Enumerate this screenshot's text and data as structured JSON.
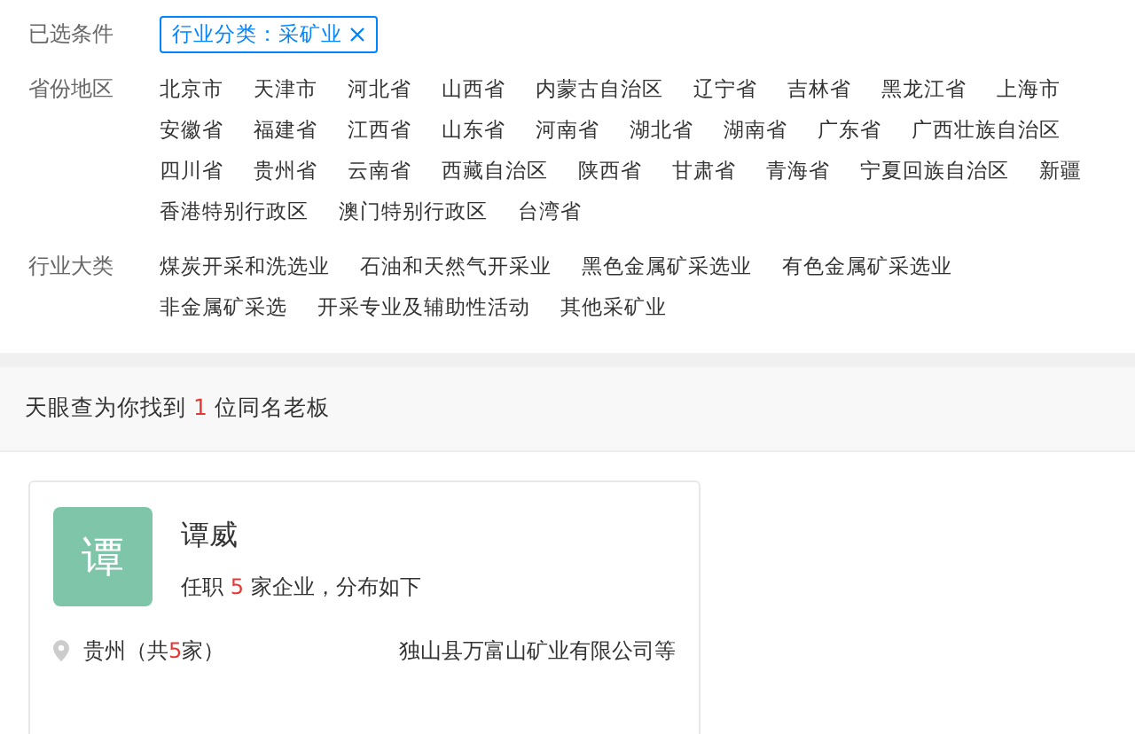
{
  "selected_conditions": {
    "label": "已选条件",
    "tags": [
      {
        "text": "行业分类：采矿业"
      }
    ]
  },
  "filters": [
    {
      "label": "省份地区",
      "options": [
        "北京市",
        "天津市",
        "河北省",
        "山西省",
        "内蒙古自治区",
        "辽宁省",
        "吉林省",
        "黑龙江省",
        "上海市",
        "安徽省",
        "福建省",
        "江西省",
        "山东省",
        "河南省",
        "湖北省",
        "湖南省",
        "广东省",
        "广西壮族自治区",
        "四川省",
        "贵州省",
        "云南省",
        "西藏自治区",
        "陕西省",
        "甘肃省",
        "青海省",
        "宁夏回族自治区",
        "新疆",
        "香港特别行政区",
        "澳门特别行政区",
        "台湾省"
      ]
    },
    {
      "label": "行业大类",
      "options": [
        "煤炭开采和洗选业",
        "石油和天然气开采业",
        "黑色金属矿采选业",
        "有色金属矿采选业",
        "非金属矿采选",
        "开采专业及辅助性活动",
        "其他采矿业"
      ]
    }
  ],
  "result_summary": {
    "prefix": "天眼查为你找到",
    "count": "1",
    "suffix": "位同名老板"
  },
  "people": [
    {
      "avatar_char": "谭",
      "name": "谭威",
      "jobs_prefix": "任职",
      "jobs_count": "5",
      "jobs_suffix": "家企业，分布如下",
      "location": "贵州（共",
      "location_count": "5",
      "location_suffix": "家）",
      "companies": "独山县万富山矿业有限公司等"
    }
  ]
}
